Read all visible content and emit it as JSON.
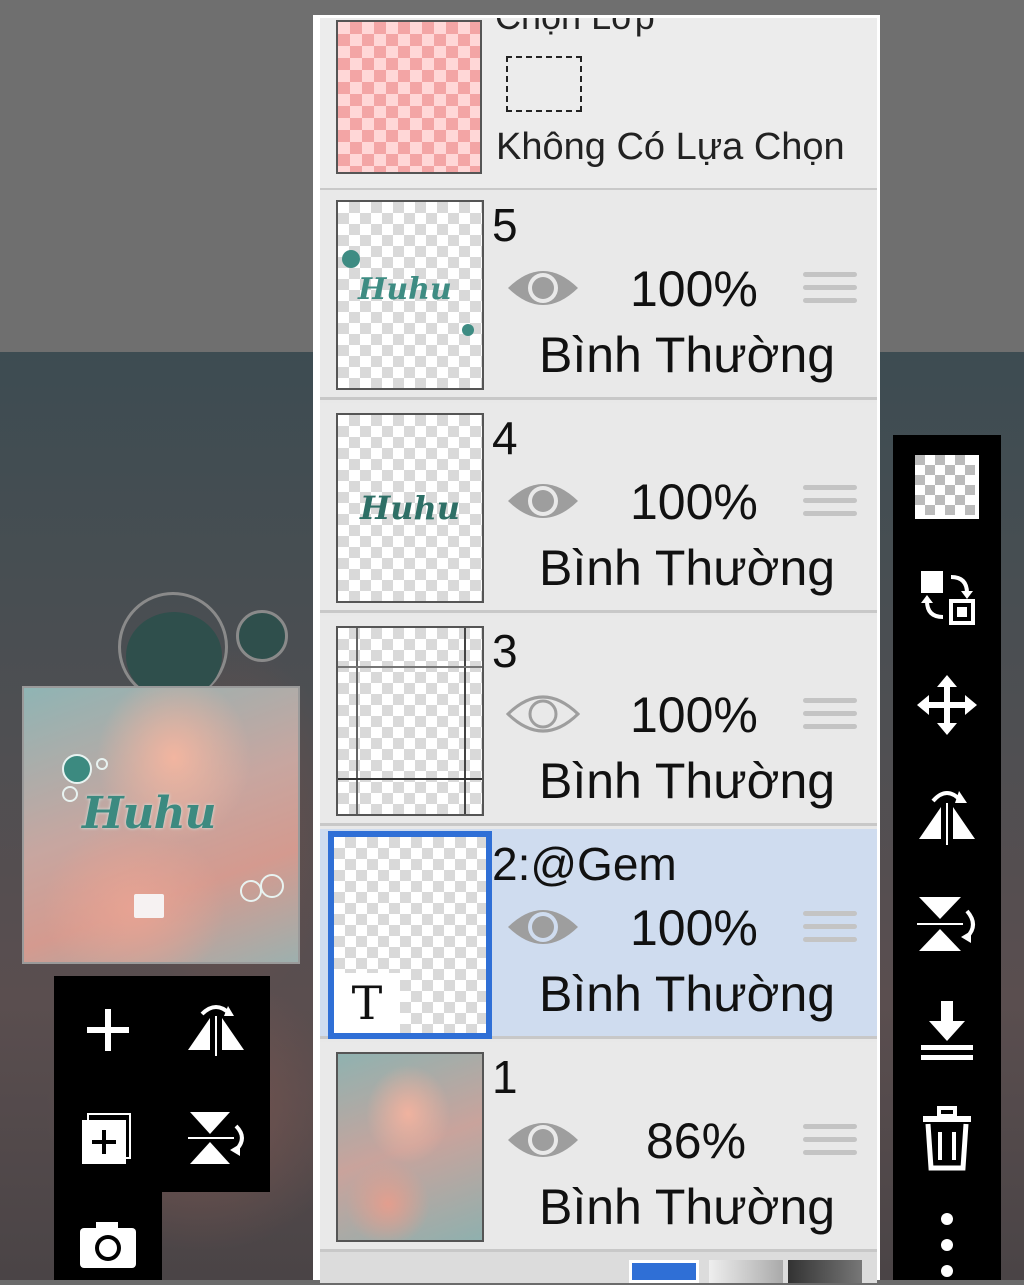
{
  "layer_panel": {
    "selection_title": "Chọn Lớp",
    "selection_status": "Không Có Lựa Chọn",
    "layers": [
      {
        "name": "5",
        "opacity": "100%",
        "blend": "Bình Thường",
        "visible": true
      },
      {
        "name": "4",
        "opacity": "100%",
        "blend": "Bình Thường",
        "visible": true
      },
      {
        "name": "3",
        "opacity": "100%",
        "blend": "Bình Thường",
        "visible": false
      },
      {
        "name": "2:@Gem",
        "opacity": "100%",
        "blend": "Bình Thường",
        "visible": true,
        "selected": true
      },
      {
        "name": "1",
        "opacity": "86%",
        "blend": "Bình Thường",
        "visible": true
      }
    ]
  },
  "canvas": {
    "art_text": "Huhu",
    "text_layer_glyph": "T"
  },
  "left_tools": [
    "add-layer-icon",
    "flip-horizontal-icon",
    "add-copy-icon",
    "flip-vertical-icon",
    "camera-icon"
  ],
  "right_tools": [
    "transparency-icon",
    "swap-layers-icon",
    "move-icon",
    "flip-horizontal-icon",
    "flip-vertical-icon",
    "merge-down-icon",
    "trash-icon",
    "more-icon"
  ],
  "colors": {
    "accent_selected": "#2f6fd6",
    "selected_row_bg": "#cfdcef",
    "art_teal": "#3e8c83"
  }
}
